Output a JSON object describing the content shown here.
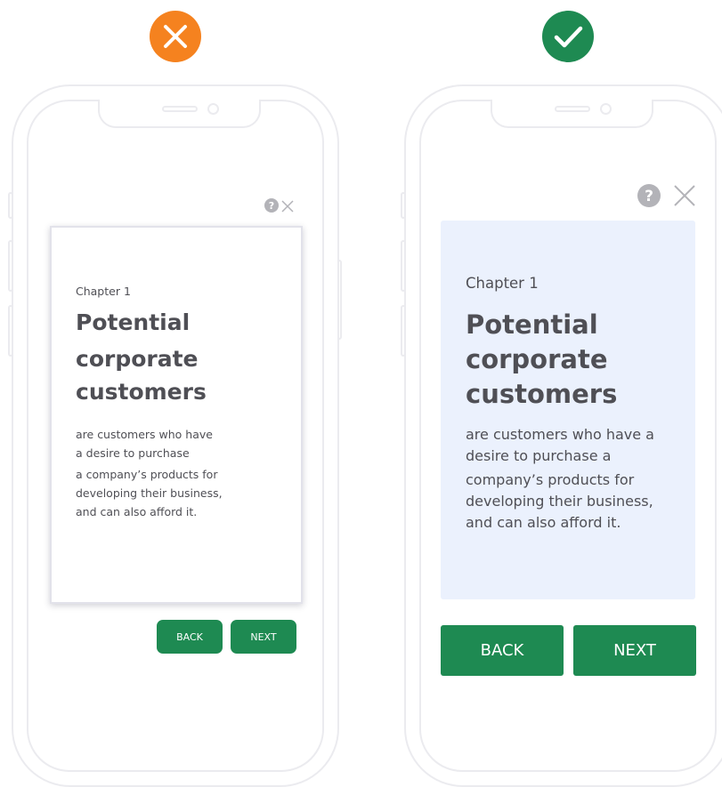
{
  "verdicts": {
    "bad_icon": "cross-icon",
    "good_icon": "check-icon",
    "bad_color": "#f5821f",
    "good_color": "#1e8a52"
  },
  "content": {
    "chapter": "Chapter 1",
    "title_lines": [
      "Potential",
      "corporate",
      "customers"
    ],
    "left_description_lines": [
      "are customers who have",
      "a desire to purchase",
      "a company’s products for",
      "developing their business,",
      "and can also afford it."
    ],
    "right_description_lines": [
      "are customers who have a",
      "desire to purchase a",
      "company’s products for",
      "developing their business,",
      "and can also afford it."
    ]
  },
  "buttons": {
    "back_label": "BACK",
    "next_label": "NEXT"
  },
  "icons": {
    "help": "question-mark-icon",
    "close": "close-icon"
  },
  "colors": {
    "button_green": "#1e8a52",
    "card_blue": "#ebf1fd",
    "text_gray": "#4f4f55",
    "icon_gray": "#b3b3b8"
  }
}
